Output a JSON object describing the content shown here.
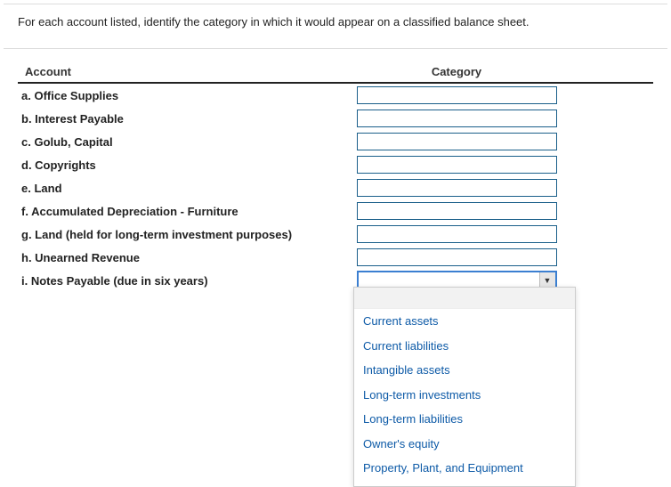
{
  "instruction": "For each account listed, identify the category in which it would appear on a classified balance sheet.",
  "headers": {
    "account": "Account",
    "category": "Category"
  },
  "rows": [
    {
      "label": "a. Office Supplies",
      "active": false
    },
    {
      "label": "b. Interest Payable",
      "active": false
    },
    {
      "label": "c. Golub, Capital",
      "active": false
    },
    {
      "label": "d. Copyrights",
      "active": false
    },
    {
      "label": "e. Land",
      "active": false
    },
    {
      "label": "f. Accumulated Depreciation - Furniture",
      "active": false
    },
    {
      "label": "g. Land (held for long-term investment purposes)",
      "active": false
    },
    {
      "label": "h. Unearned Revenue",
      "active": false
    },
    {
      "label": "i. Notes Payable (due in six years)",
      "active": true
    }
  ],
  "dropdown_options": [
    "Current assets",
    "Current liabilities",
    "Intangible assets",
    "Long-term investments",
    "Long-term liabilities",
    "Owner's equity",
    "Property, Plant, and Equipment"
  ]
}
